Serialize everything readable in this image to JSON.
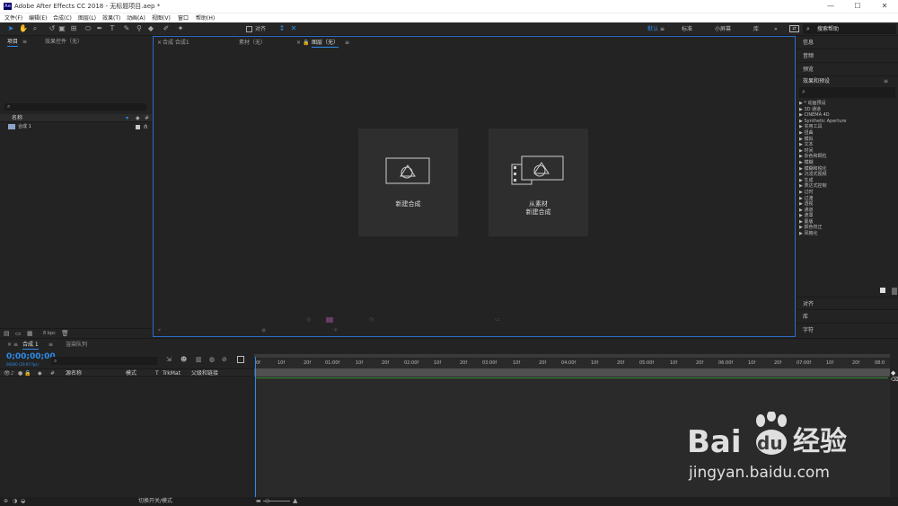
{
  "window": {
    "app_icon": "Ae",
    "title": "Adobe After Effects CC 2018 - 无标题项目.aep *",
    "min_label": "—",
    "max_label": "☐",
    "close_label": "✕"
  },
  "menu": [
    "文件(F)",
    "编辑(E)",
    "合成(C)",
    "图层(L)",
    "效果(T)",
    "动画(A)",
    "视图(V)",
    "窗口",
    "帮助(H)"
  ],
  "toolbar": {
    "align_label": "对齐",
    "workspaces": [
      "默认",
      "标准",
      "小屏幕",
      "库"
    ],
    "search_placeholder": "搜索帮助"
  },
  "project_panel": {
    "tab_project": "项目",
    "tab_effects": "效果控件（无）",
    "col_name": "名称",
    "items": [
      {
        "name": "合成 1"
      }
    ],
    "bpc": "8 bpc"
  },
  "comp_panel": {
    "tab_comp": "合成 合成1",
    "tab_footage": "素材（无）",
    "tab_layer": "图层（无）",
    "new_comp_label": "新建合成",
    "from_footage_line1": "从素材",
    "from_footage_line2": "新建合成"
  },
  "right_panel": {
    "info": "信息",
    "audio": "音频",
    "preview": "预览",
    "effects_presets": "效果和预设",
    "effects": [
      "* 动画预设",
      "3D 通道",
      "CINEMA 4D",
      "Synthetic Aperture",
      "实用工具",
      "扭曲",
      "模拟",
      "文本",
      "时间",
      "杂色和颗粒",
      "模糊",
      "模糊和锐化",
      "沉浸式视频",
      "生成",
      "表达式控制",
      "过时",
      "过渡",
      "透视",
      "通道",
      "遮罩",
      "蒙版",
      "颜色校正",
      "风格化"
    ],
    "align": "对齐",
    "library": "库",
    "character": "字符"
  },
  "timeline": {
    "tab_comp": "合成 1",
    "tab_render": "渲染队列",
    "timecode": "0;00;00;00",
    "fps": "00000 (29.97 fps)",
    "col_source": "源名称",
    "col_mode": "模式",
    "col_t": "T",
    "col_trkmat": "TrkMat",
    "col_parent": "父级和链接",
    "ruler": [
      "0f",
      "10f",
      "20f",
      "01:00f",
      "10f",
      "20f",
      "02:00f",
      "10f",
      "20f",
      "03:00f",
      "10f",
      "20f",
      "04:00f",
      "10f",
      "20f",
      "05:00f",
      "10f",
      "20f",
      "06:00f",
      "10f",
      "20f",
      "07:00f",
      "10f",
      "20f",
      "08:0"
    ],
    "switch_mode": "切换开关/模式"
  },
  "watermark": {
    "brand_bai": "Bai",
    "brand_du": "du",
    "brand_cn": "经验",
    "url": "jingyan.baidu.com"
  },
  "colors": {
    "accent": "#2d8ceb",
    "panel_border": "#2d6bc4",
    "work_area": "#3a8f3a"
  }
}
